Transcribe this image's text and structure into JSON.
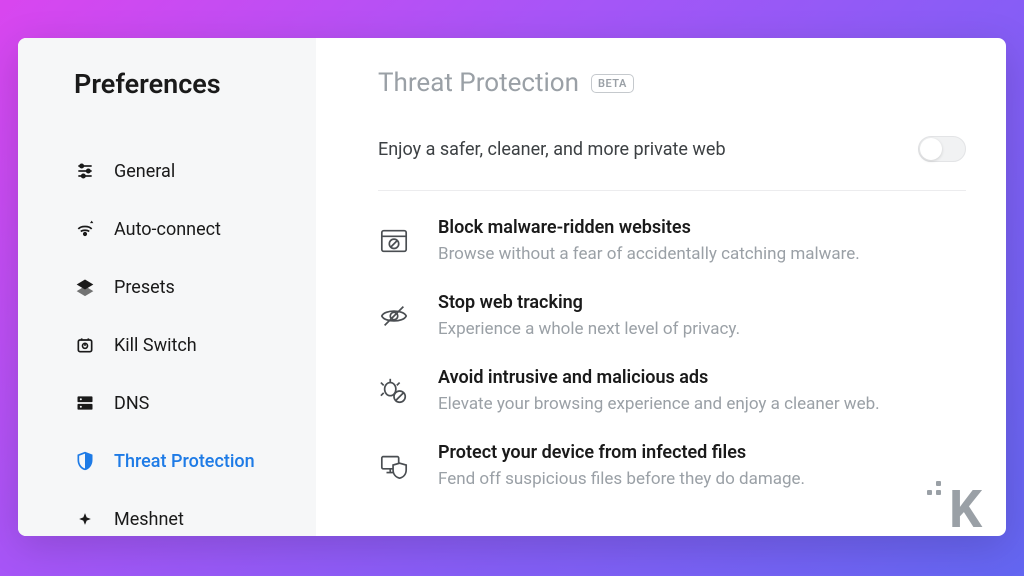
{
  "sidebar": {
    "title": "Preferences",
    "items": [
      {
        "label": "General"
      },
      {
        "label": "Auto-connect"
      },
      {
        "label": "Presets"
      },
      {
        "label": "Kill Switch"
      },
      {
        "label": "DNS"
      },
      {
        "label": "Threat Protection"
      },
      {
        "label": "Meshnet"
      }
    ]
  },
  "main": {
    "title": "Threat Protection",
    "badge": "BETA",
    "subtitle": "Enjoy a safer, cleaner, and more private web",
    "toggle_on": false,
    "features": [
      {
        "title": "Block malware-ridden websites",
        "desc": "Browse without a fear of accidentally catching malware."
      },
      {
        "title": "Stop web tracking",
        "desc": "Experience a whole next level of privacy."
      },
      {
        "title": "Avoid intrusive and malicious ads",
        "desc": "Elevate your browsing experience and enjoy a cleaner web."
      },
      {
        "title": "Protect your device from infected files",
        "desc": "Fend off suspicious files before they do damage."
      }
    ]
  },
  "watermark": "K"
}
